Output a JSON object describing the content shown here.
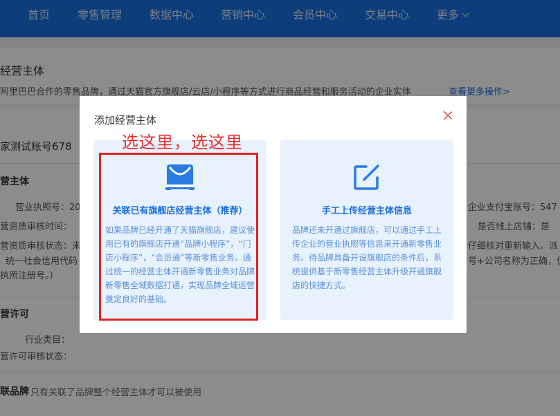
{
  "nav": {
    "items": [
      "首页",
      "零售管理",
      "数据中心",
      "营销中心",
      "会员中心",
      "交易中心",
      "更多"
    ]
  },
  "background": {
    "title": "经营主体",
    "description": "阿里巴巴合作的零售品牌，通过天猫官方旗舰店/云店/小程序等方式进行商品经营和服务活动的企业实体",
    "more_link": "查看更多操作>",
    "account": "家测试账号678",
    "section_subject": "营主体",
    "fields": {
      "license_no": "营业执照号：20",
      "review_time": "营资质审核时间：",
      "review_status": "营资质审核状态：未",
      "credit_code": "统一社会信用代码",
      "reg_no": "执照注册号。）",
      "alipay": "企业支付宝账号：547",
      "online_store": "是否线上店铺：是",
      "recheck": "仔细核对重新输入。派",
      "company_name": "号+公司名称为正确，但"
    },
    "section_license": "营许可",
    "industry": "行业类目：",
    "permit_status": "营许可审核状态：",
    "section_brand": "联品牌",
    "brand_note": "只有关联了品牌整个经营主体才可以被使用"
  },
  "modal": {
    "title": "添加经营主体",
    "options": [
      {
        "heading": "关联已有旗舰店经营主体（推荐）",
        "body": "如果品牌已经开通了天猫旗舰店，建议使用已有的旗舰店开通“品牌小程序”，“门店小程序”，“会员通”等新零售业务。通过统一的经营主体开通新零售业务对品牌新零售全域数据打通，实现品牌全域运营奠定良好的基础。",
        "icon": "shopping-bag-icon"
      },
      {
        "heading": "手工上传经营主体信息",
        "body": "品牌还未开通过旗舰店，可以通过手工上传企业的营业执照等信息来开通新零售业务。待品牌具备开设旗舰店的条件后，系统提供基于新零售经营主体升级开通旗舰店的快捷方式。",
        "icon": "edit-icon"
      }
    ]
  },
  "annotation": {
    "text": "选这里，选这里"
  },
  "colors": {
    "nav_bg": "#1a6fe0",
    "accent": "#1a6fe0",
    "annotation": "#e02222",
    "card_bg": "#e8f2fd"
  }
}
